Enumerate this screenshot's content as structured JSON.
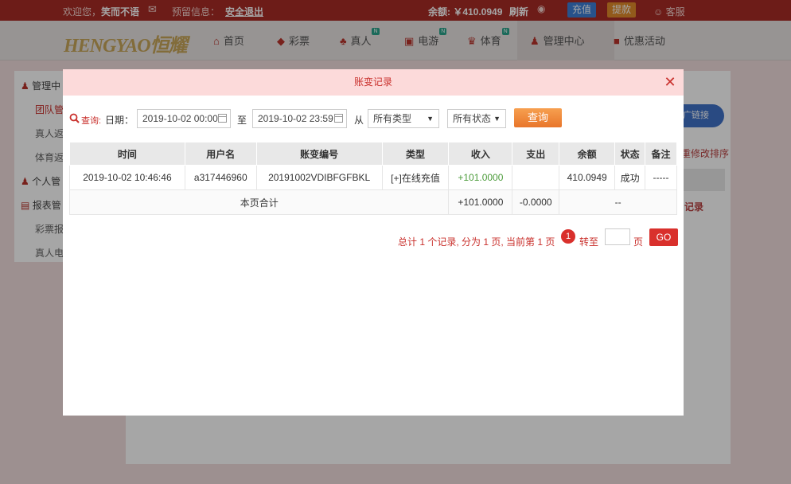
{
  "topbar": {
    "welcome": "欢迎您，",
    "username": "笑而不语",
    "reserved_info": "预留信息：",
    "logout": "安全退出",
    "balance_label": "余额: ￥410.0949",
    "refresh": "刷新",
    "deposit": "充值",
    "withdraw": "提款",
    "service": "客服"
  },
  "logo": "HENGYAO恒耀",
  "nav": {
    "items": [
      {
        "label": "首页",
        "icon": "home-icon"
      },
      {
        "label": "彩票",
        "icon": "lottery-icon"
      },
      {
        "label": "真人",
        "icon": "live-icon",
        "badge": "N"
      },
      {
        "label": "电游",
        "icon": "slot-icon",
        "badge": "N"
      },
      {
        "label": "体育",
        "icon": "trophy-icon",
        "badge": "N"
      },
      {
        "label": "管理中心",
        "icon": "users-icon"
      },
      {
        "label": "优惠活动",
        "icon": "gift-icon"
      }
    ]
  },
  "sidebar": {
    "items": [
      "管理中",
      "团队管",
      "真人返",
      "体育返",
      "个人管",
      "报表管",
      "彩票报",
      "真人电"
    ]
  },
  "background": {
    "promo": "广链接",
    "sort_text": "重修改排序",
    "record": "记录"
  },
  "modal": {
    "title": "账变记录",
    "query_label": "查询:",
    "date_label": "日期：",
    "date_from": "2019-10-02 00:00",
    "to_label": "至",
    "date_to": "2019-10-02 23:59",
    "from_label": "从",
    "type_select": "所有类型",
    "status_select": "所有状态",
    "query_button": "查询",
    "columns": [
      "时间",
      "用户名",
      "账变编号",
      "类型",
      "收入",
      "支出",
      "余额",
      "状态",
      "备注"
    ],
    "rows": [
      {
        "time": "2019-10-02 10:46:46",
        "user": "a317446960",
        "id": "20191002VDIBFGFBKL",
        "type": "[+]在线充值",
        "income": "+101.0000",
        "expense": "",
        "balance": "410.0949",
        "status": "成功",
        "note": "-----"
      }
    ],
    "summary": {
      "label": "本页合计",
      "income": "+101.0000",
      "expense": "-0.0000",
      "rest": "--"
    },
    "pager": {
      "text": "总计 1 个记录, 分为 1 页, 当前第 1 页",
      "page": "1",
      "goto": "转至",
      "page_unit": "页",
      "go": "GO"
    }
  },
  "colors": {
    "topbar": "#a82b25",
    "accent": "#d9302c",
    "query_button": "#f08b3a"
  }
}
